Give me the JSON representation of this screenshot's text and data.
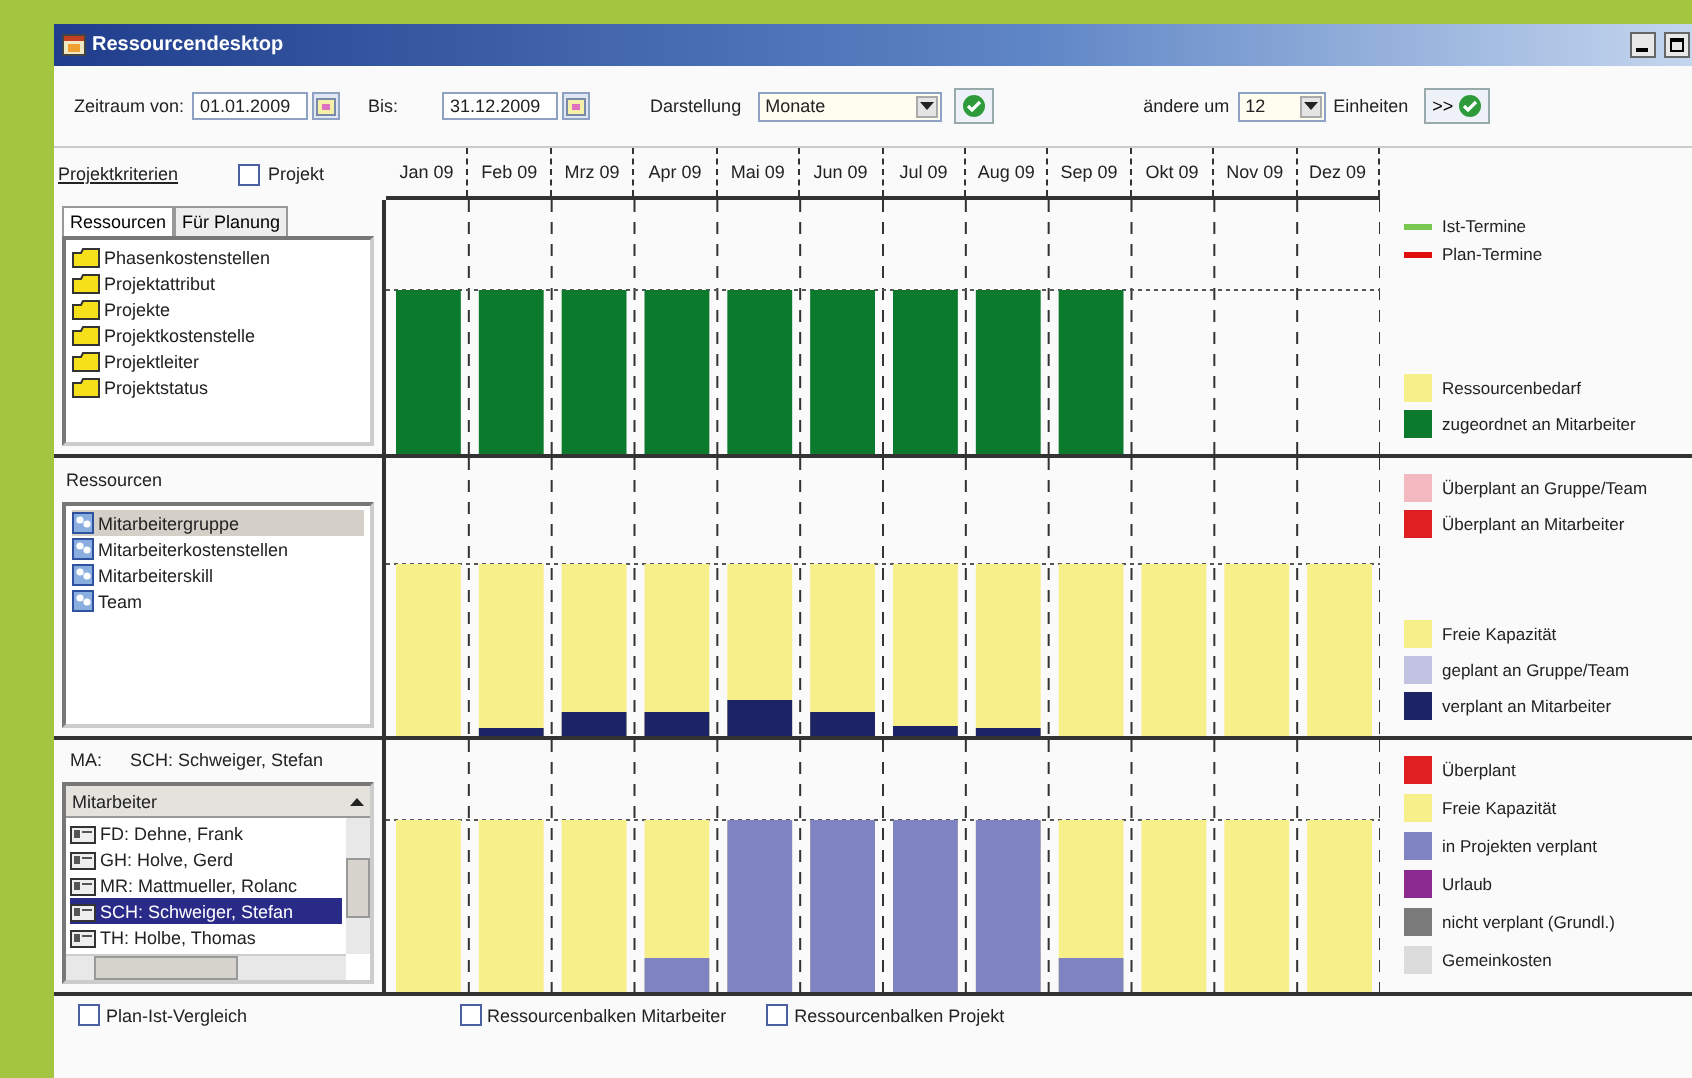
{
  "window": {
    "title": "Ressourcendesktop"
  },
  "toolbar": {
    "from_label": "Zeitraum von:",
    "from_date": "01.01.2009",
    "to_label": "Bis:",
    "to_date": "31.12.2009",
    "view_label": "Darstellung",
    "view": "Monate",
    "shift_label": "ändere um",
    "shift": "12",
    "units_label": "Einheiten",
    "units_button": ">>"
  },
  "header": {
    "criteria_label": "Projektkriterien",
    "project_checkbox": {
      "label": "Projekt",
      "checked": false
    },
    "months": [
      "Jan 09",
      "Feb 09",
      "Mrz 09",
      "Apr 09",
      "Mai 09",
      "Jun 09",
      "Jul 09",
      "Aug 09",
      "Sep 09",
      "Okt 09",
      "Nov 09",
      "Dez 09"
    ]
  },
  "panels": [
    {
      "kind": "criteria",
      "tabs": [
        {
          "label": "Ressourcen",
          "selected": true
        },
        {
          "label": "Für Planung",
          "selected": false
        }
      ],
      "items": [
        {
          "label": "Phasenkostenstellen",
          "selected": false
        },
        {
          "label": "Projektattribut",
          "selected": false
        },
        {
          "label": "Projekte",
          "selected": false
        },
        {
          "label": "Projektkostenstelle",
          "selected": false
        },
        {
          "label": "Projektleiter",
          "selected": false
        },
        {
          "label": "Projektstatus",
          "selected": false
        }
      ],
      "legend": [
        {
          "items": [
            {
              "kind": "line",
              "label": "Ist-Termine",
              "color": "#78c850"
            },
            {
              "kind": "line",
              "label": "Plan-Termine",
              "color": "#e01010"
            }
          ]
        },
        {
          "items": [
            {
              "kind": "swatch",
              "label": "Ressourcenbedarf",
              "color": "#f7ef8a"
            },
            {
              "kind": "swatch",
              "label": "zugeordnet an Mitarbeiter",
              "color": "#0b7a2c"
            }
          ]
        }
      ]
    },
    {
      "kind": "resources",
      "title": "Ressourcen",
      "items": [
        {
          "label": "Mitarbeitergruppe",
          "selected": true
        },
        {
          "label": "Mitarbeiterkostenstellen",
          "selected": false
        },
        {
          "label": "Mitarbeiterskill",
          "selected": false
        },
        {
          "label": "Team",
          "selected": false
        }
      ],
      "legend": [
        {
          "items": [
            {
              "kind": "swatch",
              "label": "Überplant an Gruppe/Team",
              "color": "#f4b8c0"
            },
            {
              "kind": "swatch",
              "label": "Überplant an Mitarbeiter",
              "color": "#e02020"
            }
          ]
        },
        {
          "items": [
            {
              "kind": "swatch",
              "label": "Freie Kapazität",
              "color": "#f7ef8a"
            },
            {
              "kind": "swatch",
              "label": "geplant an Gruppe/Team",
              "color": "#c2c2e2"
            },
            {
              "kind": "swatch",
              "label": "verplant an Mitarbeiter",
              "color": "#1c2466"
            }
          ]
        }
      ]
    },
    {
      "kind": "employees",
      "ma_label": "MA:",
      "ma_value": "SCH: Schweiger, Stefan",
      "list_header": "Mitarbeiter",
      "items": [
        {
          "label": "FD: Dehne, Frank",
          "selected": false
        },
        {
          "label": "GH: Holve, Gerd",
          "selected": false
        },
        {
          "label": "MR: Mattmueller, Rolanc",
          "selected": false
        },
        {
          "label": "SCH: Schweiger, Stefan",
          "selected": true
        },
        {
          "label": "TH: Holbe, Thomas",
          "selected": false
        }
      ],
      "legend": [
        {
          "items": [
            {
              "kind": "swatch",
              "label": "Überplant",
              "color": "#e02020"
            },
            {
              "kind": "swatch",
              "label": "Freie Kapazität",
              "color": "#f7ef8a"
            },
            {
              "kind": "swatch",
              "label": "in Projekten verplant",
              "color": "#7f83c2"
            },
            {
              "kind": "swatch",
              "label": "Urlaub",
              "color": "#8c2a90"
            },
            {
              "kind": "swatch",
              "label": "nicht verplant (Grundl.)",
              "color": "#7a7a7a"
            },
            {
              "kind": "swatch",
              "label": "Gemeinkosten",
              "color": "#dcdcdc"
            }
          ]
        }
      ]
    }
  ],
  "options": [
    {
      "label": "Plan-Ist-Vergleich",
      "checked": false
    },
    {
      "label": "Ressourcenbalken Mitarbeiter",
      "checked": false
    },
    {
      "label": "Ressourcenbalken Projekt",
      "checked": false
    }
  ]
}
